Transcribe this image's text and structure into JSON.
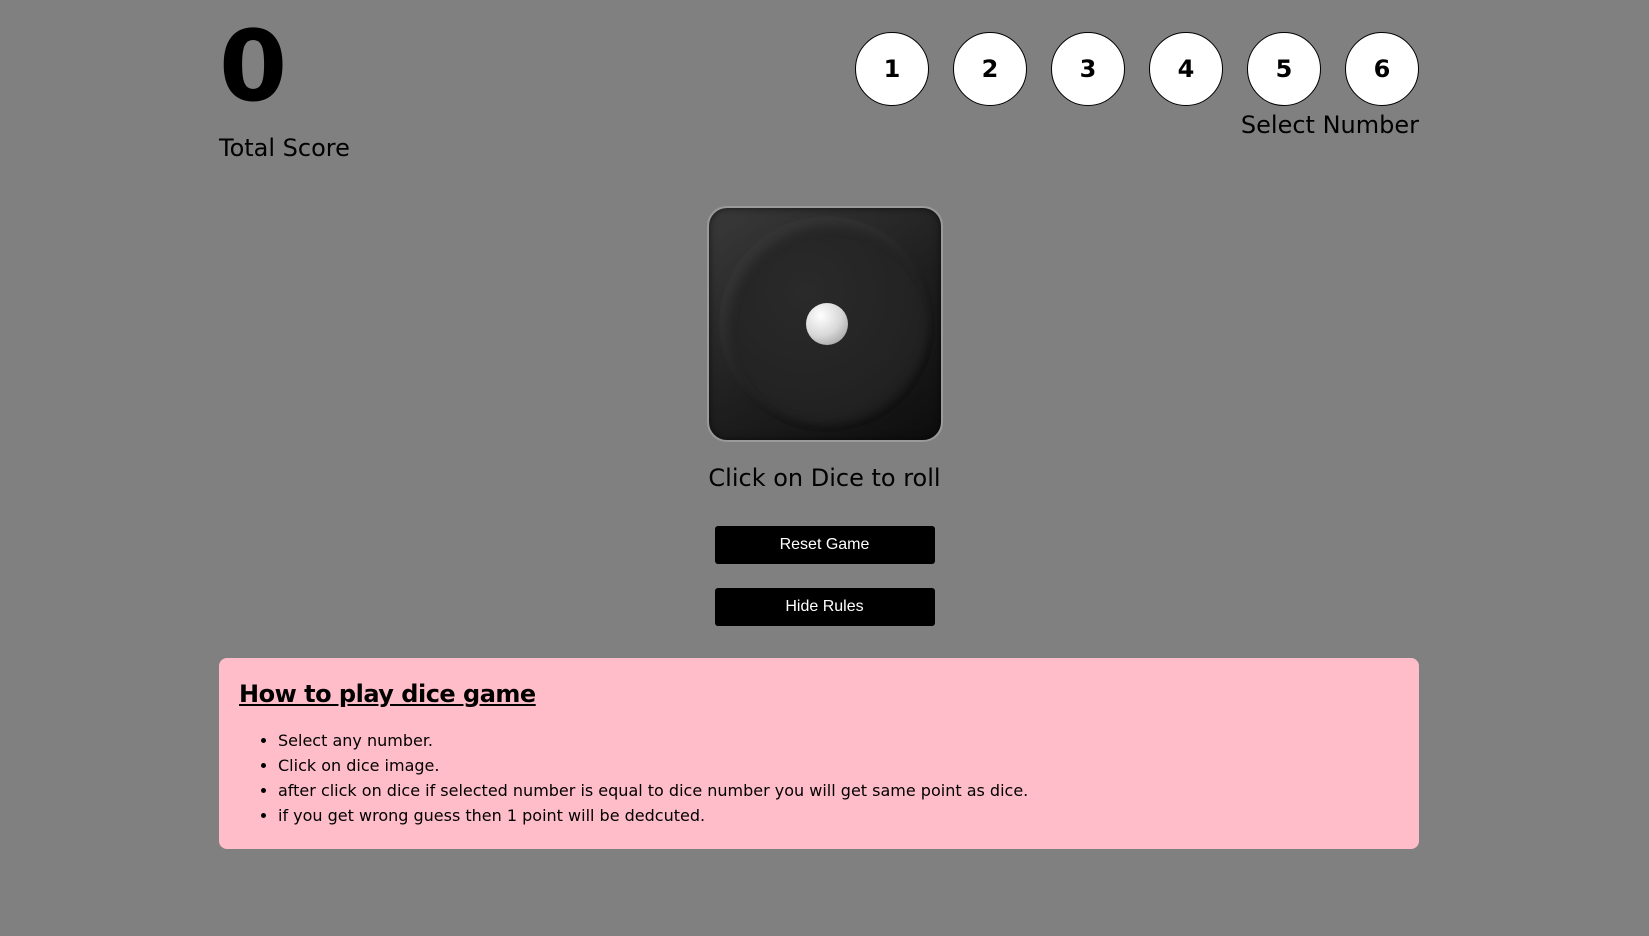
{
  "score": {
    "value": "0",
    "label": "Total Score"
  },
  "number_select": {
    "options": [
      "1",
      "2",
      "3",
      "4",
      "5",
      "6"
    ],
    "label": "Select Number"
  },
  "dice": {
    "current_face": 1,
    "hint": "Click on Dice to roll"
  },
  "buttons": {
    "reset": "Reset Game",
    "toggle_rules": "Hide Rules"
  },
  "rules": {
    "title": "How to play dice game",
    "items": [
      "Select any number.",
      "Click on dice image.",
      "after click on dice if selected number is equal to dice number you will get same point as dice.",
      "if you get wrong guess then 1 point will be dedcuted."
    ]
  },
  "colors": {
    "background": "#808080",
    "rules_panel": "#ffbcc9",
    "button_bg": "#000000",
    "button_text": "#ffffff"
  }
}
